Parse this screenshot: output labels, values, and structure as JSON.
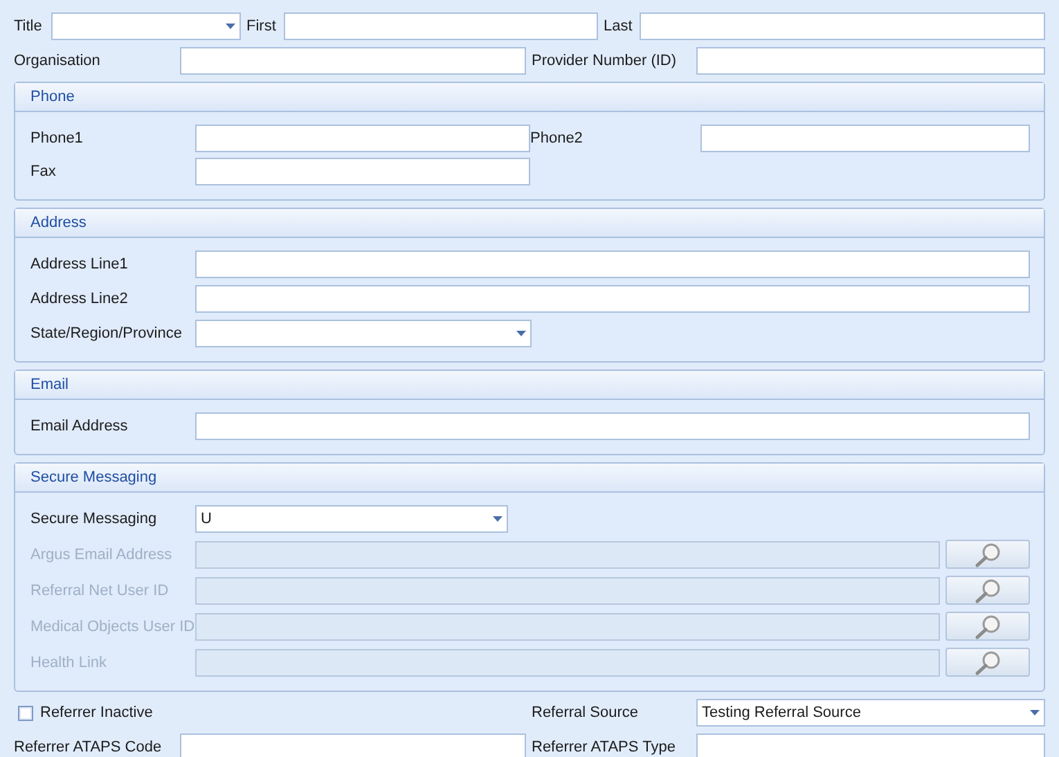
{
  "name_row": [
    {
      "label": "Title",
      "kind": "dropdown"
    },
    {
      "label": "First",
      "kind": "text"
    },
    {
      "label": "Last",
      "kind": "text"
    }
  ],
  "org_row": [
    {
      "label": "Organisation",
      "kind": "text"
    },
    {
      "label": "Provider Number (ID)",
      "kind": "text"
    }
  ],
  "sections": [
    {
      "title": "Phone",
      "kind": "two_column",
      "fields": [
        {
          "label": "Phone1",
          "kind": "text"
        },
        {
          "label": "Phone2",
          "kind": "text"
        },
        {
          "label": "Fax",
          "kind": "text"
        }
      ]
    },
    {
      "title": "Address",
      "kind": "single",
      "fields": [
        {
          "label": "Address Line1",
          "kind": "text"
        },
        {
          "label": "Address Line2",
          "kind": "text"
        },
        {
          "label": "State/Region/Province",
          "kind": "dropdown"
        }
      ]
    },
    {
      "title": "Email",
      "kind": "single",
      "fields": [
        {
          "label": "Email Address",
          "kind": "text"
        }
      ]
    },
    {
      "title": "Secure Messaging",
      "kind": "single",
      "fields": [
        {
          "label": "Secure Messaging",
          "kind": "dropdown",
          "value": "U",
          "disabled": false
        },
        {
          "label": "Argus Email Address",
          "kind": "lookup",
          "disabled": true
        },
        {
          "label": "Referral Net User ID",
          "kind": "lookup",
          "disabled": true
        },
        {
          "label": "Medical Objects User ID",
          "kind": "lookup",
          "disabled": true
        },
        {
          "label": "Health Link",
          "kind": "lookup",
          "disabled": true
        }
      ]
    }
  ],
  "referrer_inactive": {
    "label": "Referrer Inactive",
    "checked": false
  },
  "referral_source": {
    "label": "Referral Source",
    "kind": "dropdown",
    "value": "Testing Referral Source"
  },
  "ataps_row": [
    {
      "label": "Referrer ATAPS Code",
      "kind": "text"
    },
    {
      "label": "Referrer ATAPS Type",
      "kind": "text"
    }
  ]
}
